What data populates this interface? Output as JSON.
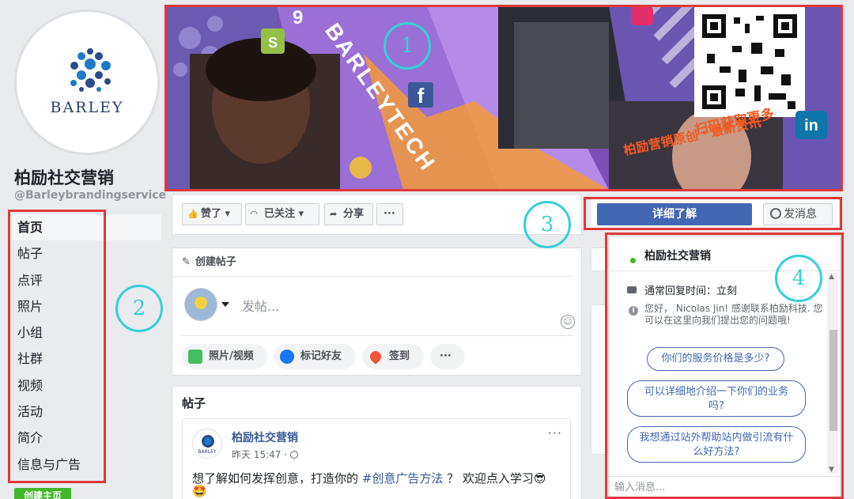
{
  "page": {
    "name": "柏励社交营销",
    "handle": "@Barleybrandingservice",
    "logo_text": "BARLEY"
  },
  "nav": {
    "items": [
      "首页",
      "帖子",
      "点评",
      "照片",
      "小组",
      "社群",
      "视频",
      "活动",
      "简介",
      "信息与广告"
    ],
    "create_page_label": "创建主页"
  },
  "cover": {
    "brand_text": "BARLEYTECH",
    "badge_number": "9",
    "caption_line1": "扫码获取更多",
    "caption_line2": "柏励营销原创 · 最新资讯",
    "social_f": "f",
    "social_in": "in"
  },
  "actions": {
    "like_label": "赞了",
    "follow_label": "已关注",
    "share_label": "分享",
    "more_label": "···",
    "learn_more_label": "详细了解",
    "message_label": "发消息"
  },
  "create_post": {
    "title": "创建帖子",
    "placeholder": "发帖...",
    "photo_video": "照片/视频",
    "tag_friends": "标记好友",
    "check_in": "签到",
    "more": "···"
  },
  "posts": {
    "title": "帖子",
    "author": "柏励社交营销",
    "avatar_text": "BARLEY",
    "time": "昨天 15:47 · ",
    "text_before": "想了解如何发挥创意，打造你的 ",
    "hashtag": "#创意广告方法",
    "text_after": " ？ 欢迎点入学习😎",
    "text_line2": "🤩",
    "more": "···"
  },
  "messenger": {
    "name": "柏励社交营销",
    "reply_time": "通常回复时间：立刻",
    "greeting": "您好， Nicolas Jin! 感谢联系柏励科技. 您可以在这里向我们提出您的问题哦!",
    "quick_replies": [
      "你们的服务价格是多少?",
      "可以详细地介绍一下你们的业务吗?",
      "我想通过站外帮助站内做引流有什么好方法?"
    ],
    "input_placeholder": "输入消息..."
  },
  "annotations": [
    "1",
    "2",
    "3",
    "4"
  ],
  "colors": {
    "facebook_blue": "#4267b2",
    "link_blue": "#365899",
    "annotation_red": "#e0383b",
    "annotation_cyan": "#33d1d6",
    "create_green": "#42b72a"
  }
}
